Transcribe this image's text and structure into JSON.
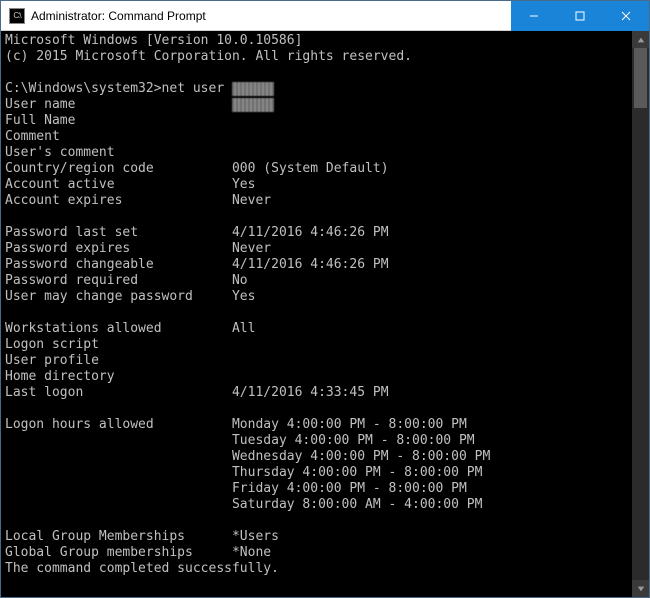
{
  "titlebar": {
    "title": "Administrator: Command Prompt",
    "icon_label": "C:\\"
  },
  "banner": {
    "line1": "Microsoft Windows [Version 10.0.10586]",
    "line2": "(c) 2015 Microsoft Corporation. All rights reserved."
  },
  "prompt": {
    "path": "C:\\Windows\\system32>",
    "command": "net user ",
    "argument_redacted": true
  },
  "fields": [
    {
      "label": "User name",
      "value": "",
      "redacted": true
    },
    {
      "label": "Full Name",
      "value": ""
    },
    {
      "label": "Comment",
      "value": ""
    },
    {
      "label": "User's comment",
      "value": ""
    },
    {
      "label": "Country/region code",
      "value": "000 (System Default)"
    },
    {
      "label": "Account active",
      "value": "Yes"
    },
    {
      "label": "Account expires",
      "value": "Never"
    }
  ],
  "fields2": [
    {
      "label": "Password last set",
      "value": "4/11/2016 4:46:26 PM"
    },
    {
      "label": "Password expires",
      "value": "Never"
    },
    {
      "label": "Password changeable",
      "value": "4/11/2016 4:46:26 PM"
    },
    {
      "label": "Password required",
      "value": "No"
    },
    {
      "label": "User may change password",
      "value": "Yes"
    }
  ],
  "fields3": [
    {
      "label": "Workstations allowed",
      "value": "All"
    },
    {
      "label": "Logon script",
      "value": ""
    },
    {
      "label": "User profile",
      "value": ""
    },
    {
      "label": "Home directory",
      "value": ""
    },
    {
      "label": "Last logon",
      "value": "4/11/2016 4:33:45 PM"
    }
  ],
  "logon_hours": {
    "label": "Logon hours allowed",
    "values": [
      "Monday 4:00:00 PM - 8:00:00 PM",
      "Tuesday 4:00:00 PM - 8:00:00 PM",
      "Wednesday 4:00:00 PM - 8:00:00 PM",
      "Thursday 4:00:00 PM - 8:00:00 PM",
      "Friday 4:00:00 PM - 8:00:00 PM",
      "Saturday 8:00:00 AM - 4:00:00 PM"
    ]
  },
  "memberships": [
    {
      "label": "Local Group Memberships",
      "value": "*Users"
    },
    {
      "label": "Global Group memberships",
      "value": "*None"
    }
  ],
  "footer": "The command completed successfully.",
  "label_column_width": 29
}
